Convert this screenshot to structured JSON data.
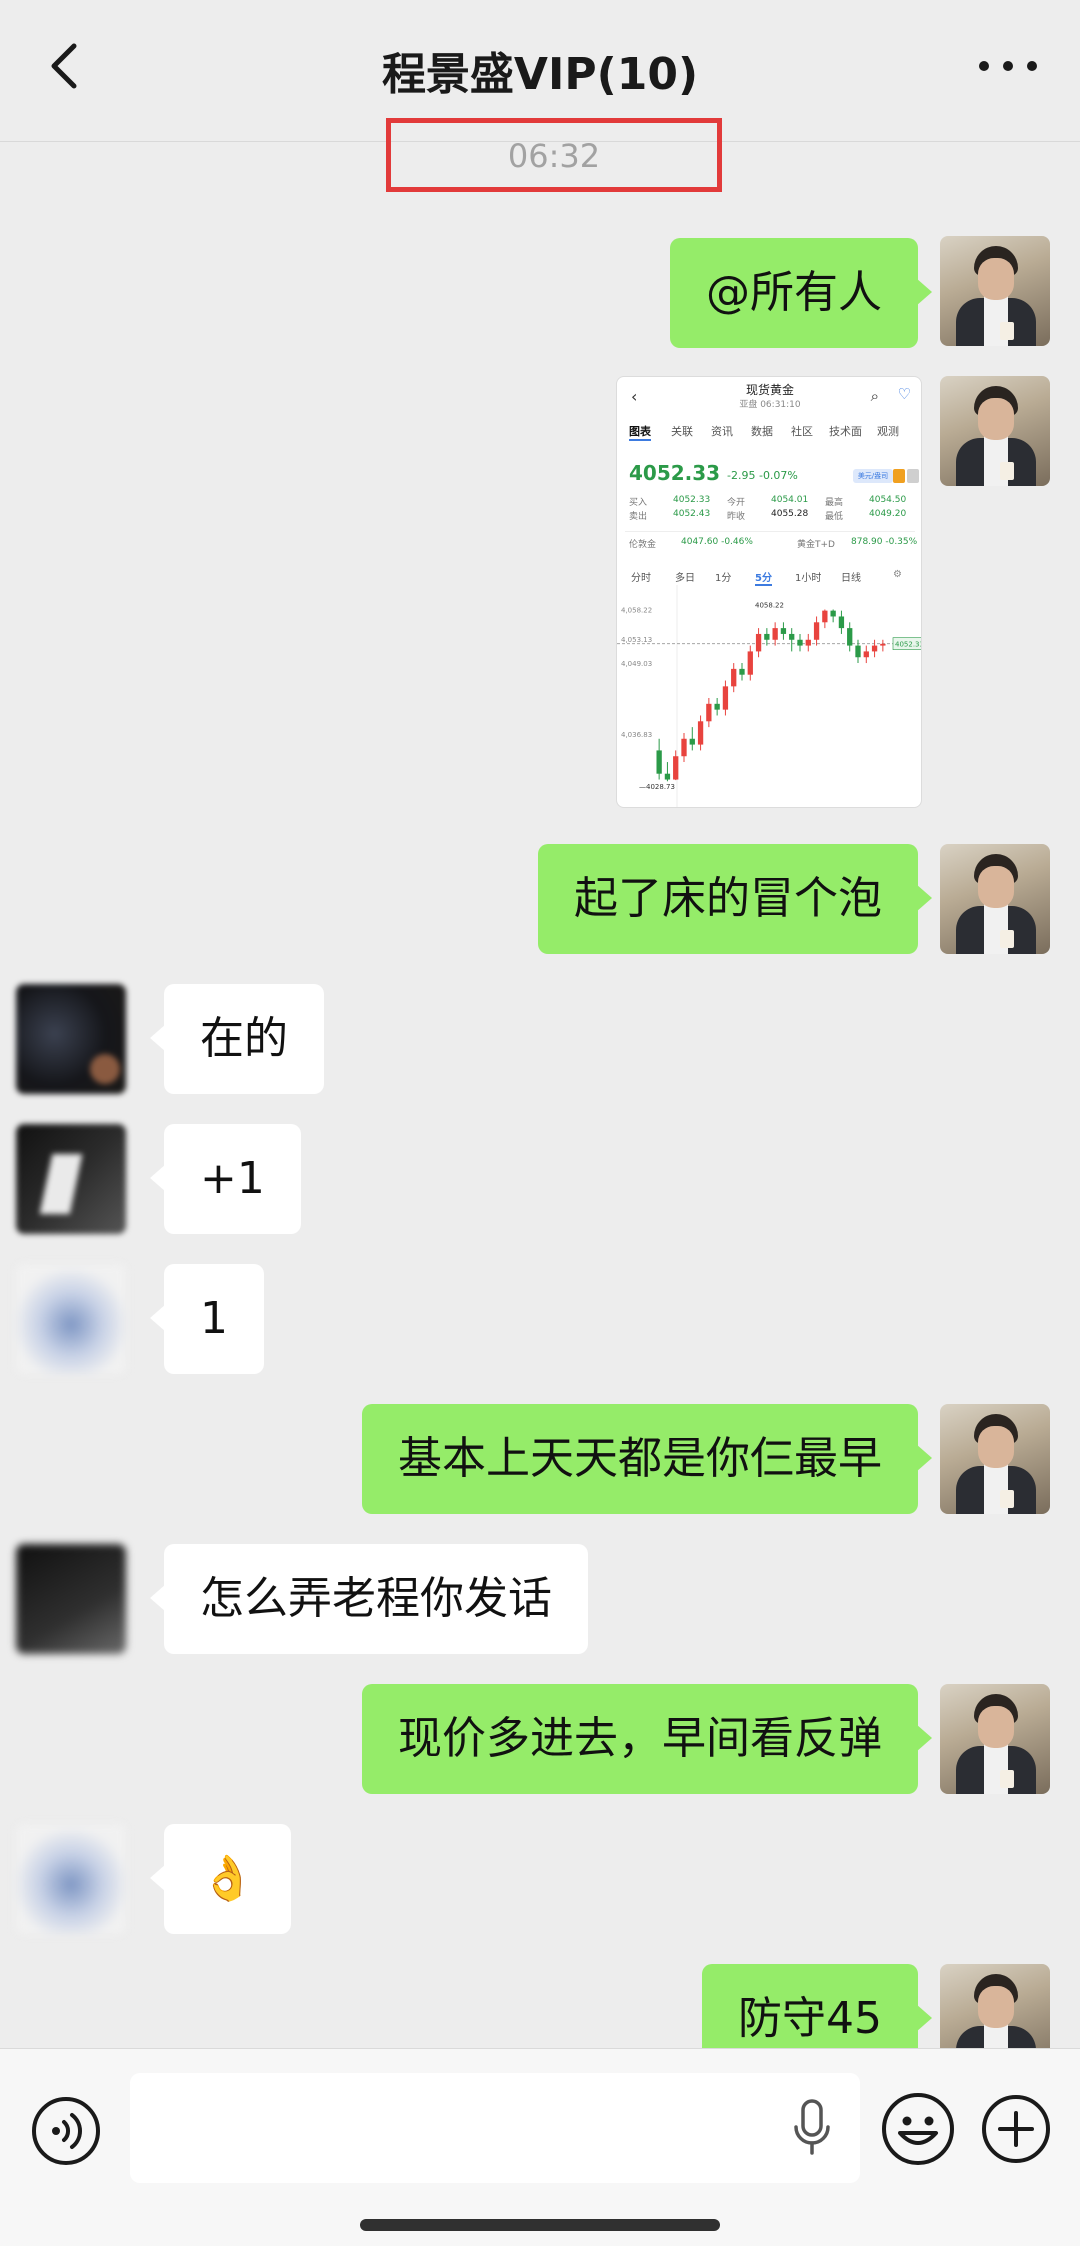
{
  "header": {
    "title": "程景盛VIP(10)"
  },
  "timestamp": "06:32",
  "messages": [
    {
      "text": "@所有人"
    },
    {
      "text": "起了床的冒个泡"
    },
    {
      "text": "在的"
    },
    {
      "text": "+1"
    },
    {
      "text": "1"
    },
    {
      "text": "基本上天天都是你仨最早"
    },
    {
      "text": "怎么弄老程你发话"
    },
    {
      "text": "现价多进去，早间看反弹"
    },
    {
      "text": "👌"
    },
    {
      "text": "防守45"
    }
  ],
  "chart_image": {
    "title": "现货黄金",
    "subtitle": "亚盘  06:31:10",
    "tabs": [
      "图表",
      "关联",
      "资讯",
      "数据",
      "社区",
      "技术面",
      "观测"
    ],
    "active_tab": "图表",
    "price": "4052.33",
    "change": "-2.95",
    "change_pct": "-0.07%",
    "badge": "美元/盎司",
    "stats": {
      "buy_label": "买入",
      "buy": "4052.33",
      "sell_label": "卖出",
      "sell": "4052.43",
      "open_label": "今开",
      "open": "4054.01",
      "prev_label": "昨收",
      "prev": "4055.28",
      "high_label": "最高",
      "high": "4054.50",
      "low_label": "最低",
      "low": "4049.20"
    },
    "ref_left_label": "伦敦金",
    "ref_left": "4047.60 -0.46%",
    "ref_right_label": "黄金T+D",
    "ref_right": "878.90 -0.35%",
    "periods": [
      "分时",
      "多日",
      "1分",
      "5分",
      "1小时",
      "日线"
    ],
    "active_period": "5分",
    "colors": {
      "up": "#e8433e",
      "down": "#2b9a48",
      "accent": "#3d7be0"
    },
    "chart_data": {
      "type": "candlestick",
      "y_ticks": [
        "4,058.22",
        "4,053.13",
        "4,049.03",
        "4,036.83"
      ],
      "y_ticks_numeric": [
        4058.22,
        4053.13,
        4049.03,
        4036.83
      ],
      "high_label": "4058.22",
      "low_label": "4028.73",
      "last_label": "4052.33",
      "ylim": [
        4026,
        4060
      ],
      "candles": [
        [
          4034,
          4030,
          4036,
          4029
        ],
        [
          4030,
          4029,
          4032,
          4028.7
        ],
        [
          4029,
          4033,
          4034,
          4028.9
        ],
        [
          4033,
          4036,
          4037,
          4032
        ],
        [
          4036,
          4035,
          4038,
          4034
        ],
        [
          4035,
          4039,
          4040,
          4034
        ],
        [
          4039,
          4042,
          4043,
          4038
        ],
        [
          4042,
          4041,
          4043,
          4040
        ],
        [
          4041,
          4045,
          4046,
          4040
        ],
        [
          4045,
          4048,
          4049,
          4044
        ],
        [
          4048,
          4047,
          4049,
          4046
        ],
        [
          4047,
          4051,
          4052,
          4046
        ],
        [
          4051,
          4054,
          4055,
          4050
        ],
        [
          4054,
          4053,
          4055,
          4052
        ],
        [
          4053,
          4055,
          4056,
          4052
        ],
        [
          4055,
          4054,
          4056,
          4053
        ],
        [
          4054,
          4053,
          4055,
          4051
        ],
        [
          4053,
          4052,
          4054,
          4051
        ],
        [
          4052,
          4053,
          4054,
          4051
        ],
        [
          4053,
          4056,
          4057,
          4052
        ],
        [
          4056,
          4058,
          4058.2,
          4055
        ],
        [
          4058,
          4057,
          4058.2,
          4056
        ],
        [
          4057,
          4055,
          4058,
          4054
        ],
        [
          4055,
          4052,
          4056,
          4051
        ],
        [
          4052,
          4050,
          4053,
          4049
        ],
        [
          4050,
          4051,
          4052,
          4049
        ],
        [
          4051,
          4052,
          4053,
          4050
        ],
        [
          4052,
          4052.3,
          4053,
          4051
        ]
      ]
    }
  }
}
